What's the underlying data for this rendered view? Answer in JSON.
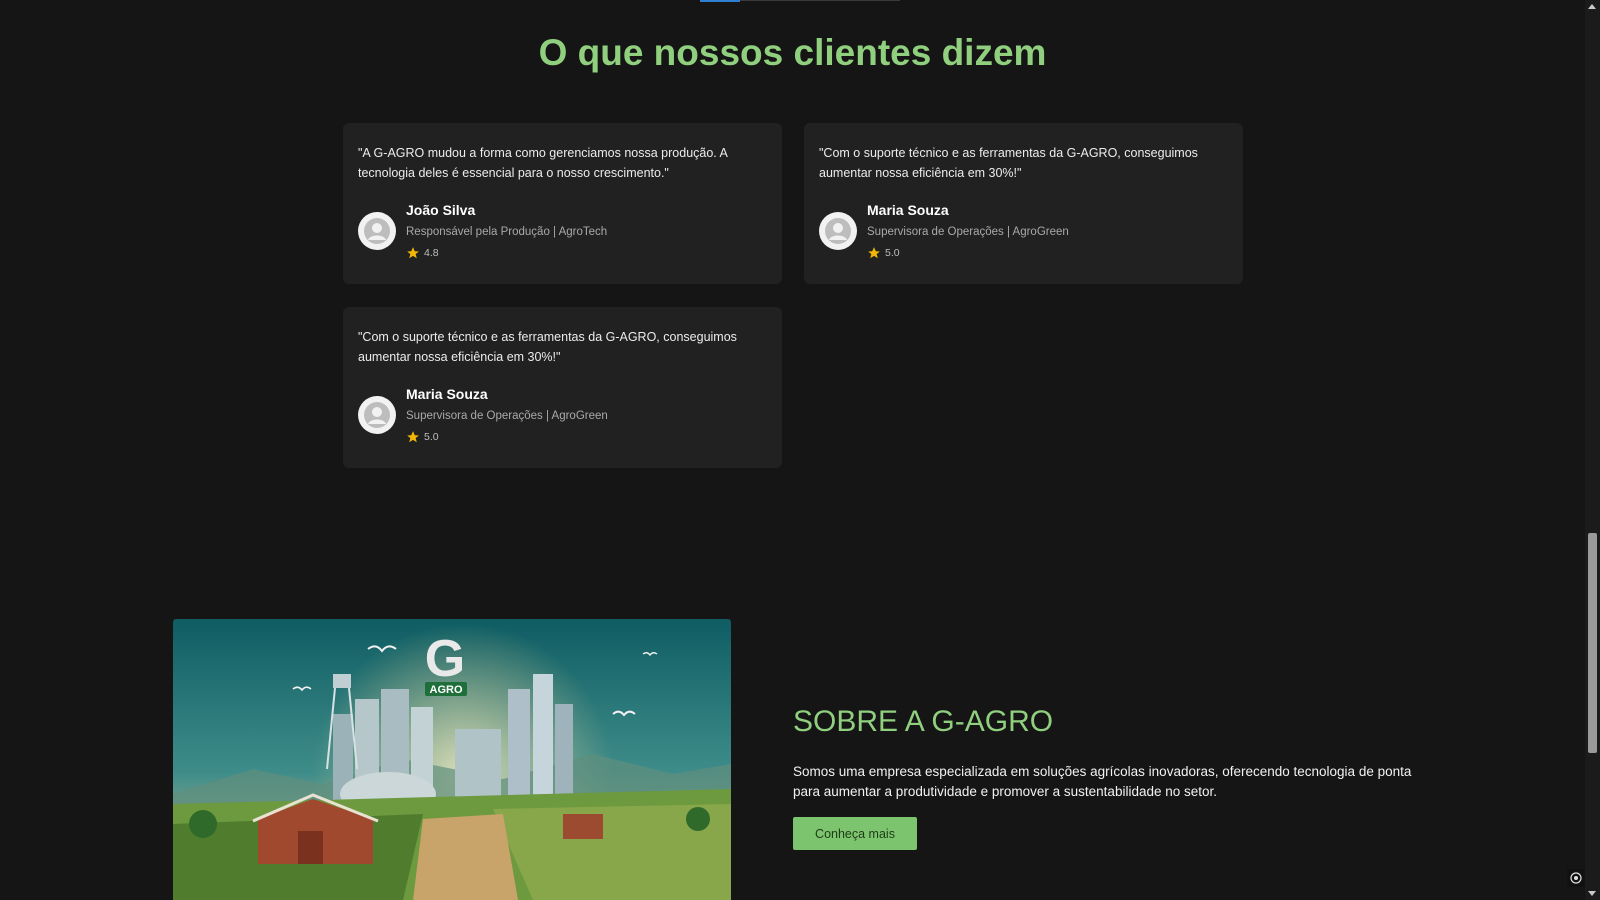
{
  "testimonials": {
    "title": "O que nossos clientes dizem",
    "items": [
      {
        "quote": "\"A G-AGRO mudou a forma como gerenciamos nossa produção. A tecnologia deles é essencial para o nosso crescimento.\"",
        "name": "João Silva",
        "role": "Responsável pela Produção | AgroTech",
        "rating": "4.8"
      },
      {
        "quote": "\"Com o suporte técnico e as ferramentas da G-AGRO, conseguimos aumentar nossa eficiência em 30%!\"",
        "name": "Maria Souza",
        "role": "Supervisora de Operações | AgroGreen",
        "rating": "5.0"
      },
      {
        "quote": "\"Com o suporte técnico e as ferramentas da G-AGRO, conseguimos aumentar nossa eficiência em 30%!\"",
        "name": "Maria Souza",
        "role": "Supervisora de Operações | AgroGreen",
        "rating": "5.0"
      }
    ]
  },
  "about": {
    "logo_letter": "G",
    "logo_text": "AGRO",
    "title": "SOBRE A G-AGRO",
    "text": "Somos uma empresa especializada em soluções agrícolas inovadoras, oferecendo tecnologia de ponta para aumentar a produtividade e promover a sustentabilidade no setor.",
    "button_label": "Conheça mais"
  },
  "colors": {
    "accent": "#8fcf7e",
    "button": "#7cc46d",
    "card": "#212121",
    "background": "#151515",
    "star": "#f2b705"
  }
}
